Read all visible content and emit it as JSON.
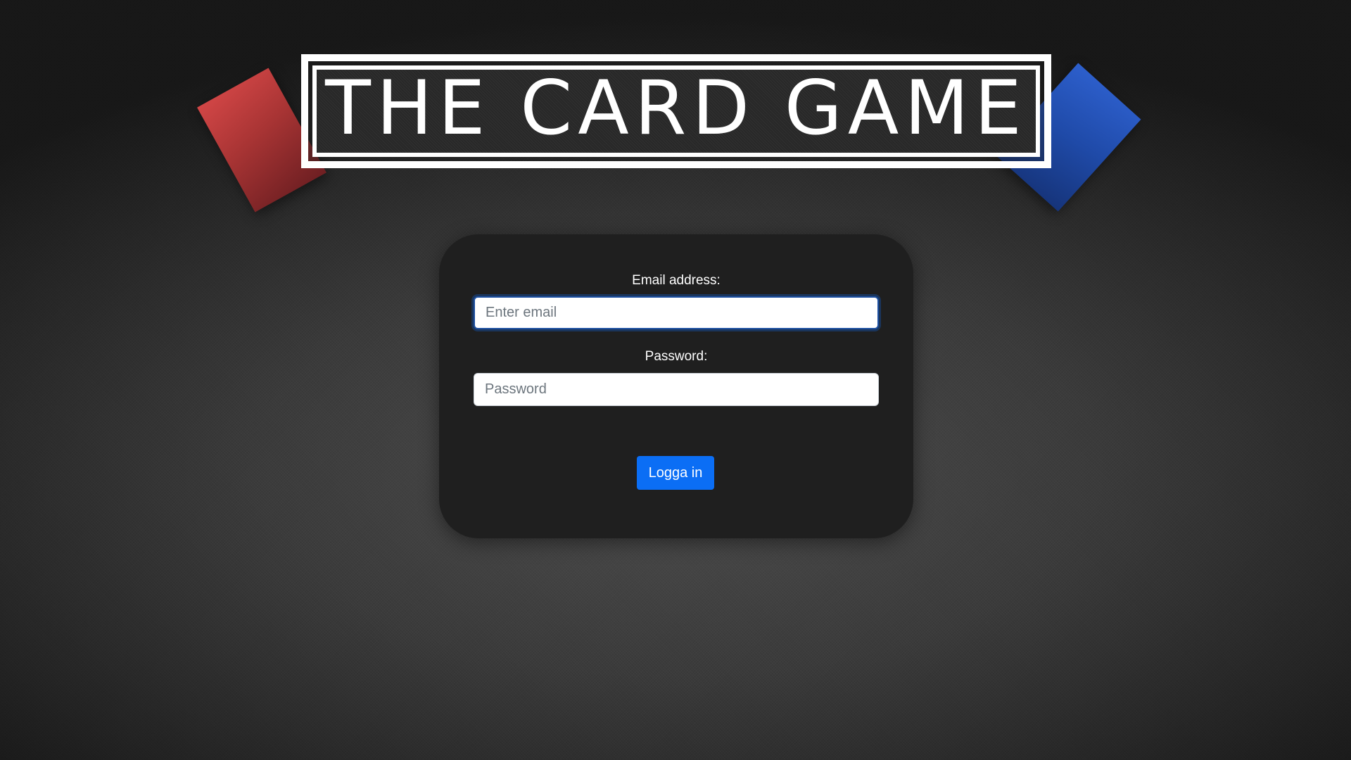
{
  "app": {
    "title": "THE CARD GAME"
  },
  "login": {
    "email_label": "Email address:",
    "email_placeholder": "Enter email",
    "email_value": "",
    "password_label": "Password:",
    "password_placeholder": "Password",
    "password_value": "",
    "submit_label": "Logga in"
  },
  "decorations": {
    "left_card": {
      "icon": "red-card-icon",
      "color": "#c44040"
    },
    "right_card": {
      "icon": "blue-card-icon",
      "color": "#1f4aa8"
    }
  },
  "colors": {
    "accent": "#0b6ef5",
    "panel": "#1f1f1f",
    "background": "#3a3a3a"
  }
}
